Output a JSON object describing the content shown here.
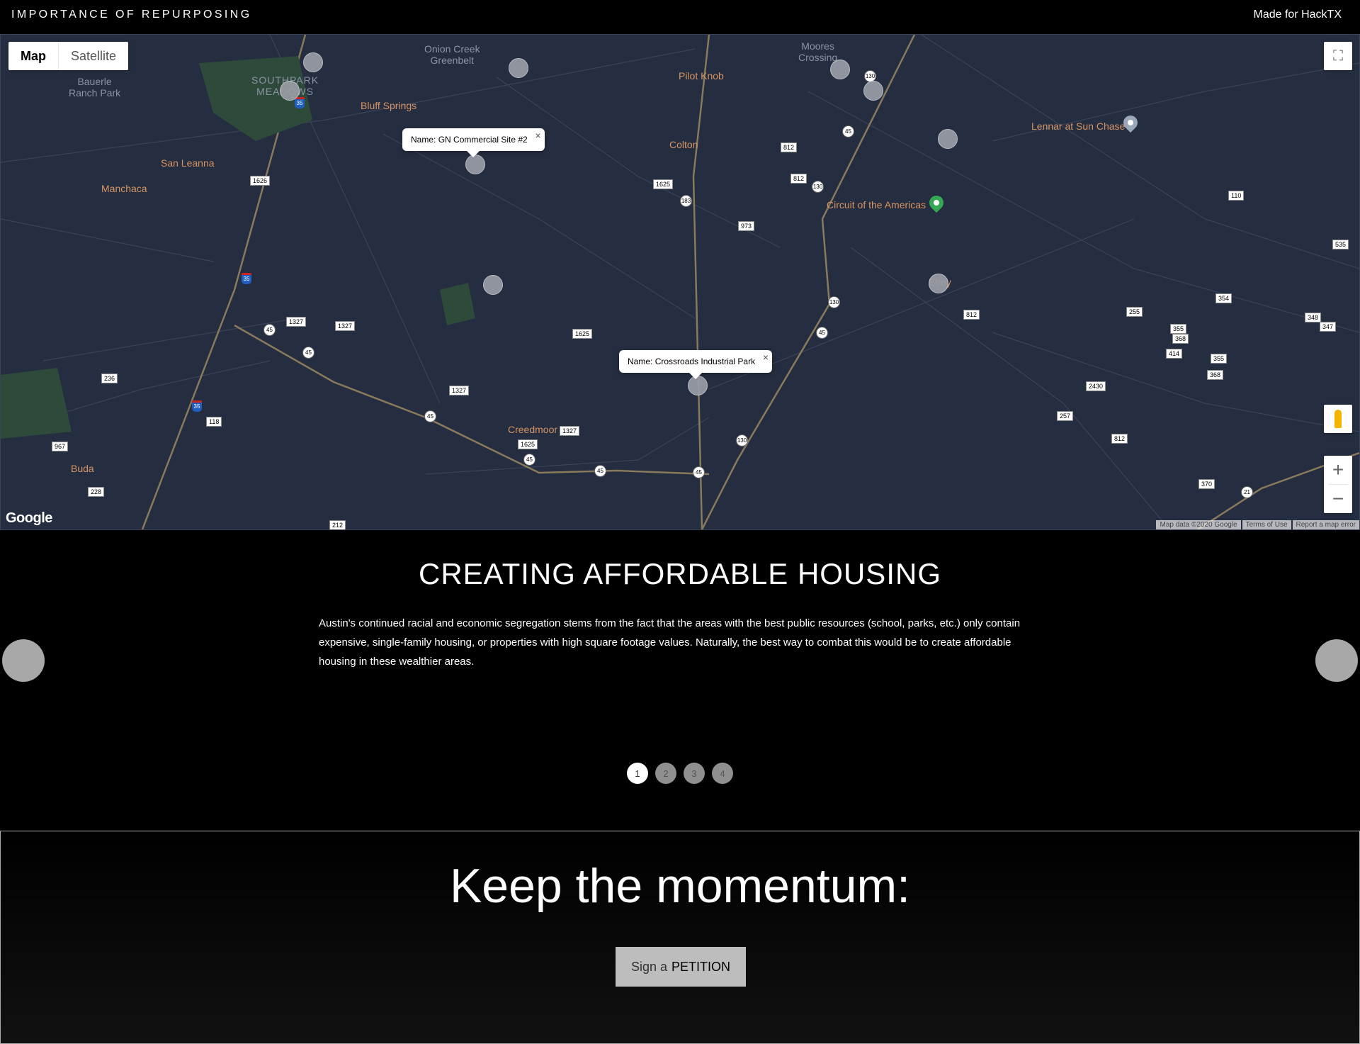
{
  "header": {
    "title": "IMPORTANCE OF REPURPOSING",
    "credit": "Made for HackTX"
  },
  "map": {
    "type_controls": {
      "map_label": "Map",
      "satellite_label": "Satellite",
      "selected": "Map"
    },
    "google_logo": "Google",
    "attribution": {
      "data": "Map data ©2020 Google",
      "terms": "Terms of Use",
      "report": "Report a map error"
    },
    "colors": {
      "background": "#252d40",
      "place_label": "#d59563",
      "marker": "#9a9da6",
      "green_pin": "#34a853"
    },
    "places": {
      "onion_creek": "Onion Creek\nGreenbelt",
      "moores_crossing": "Moores\nCrossing",
      "bauerle": "Bauerle\nRanch Park",
      "southpark": "SOUTHPARK\nMEADOWS",
      "bluff_springs": "Bluff Springs",
      "pilot_knob": "Pilot Knob",
      "san_leanna": "San Leanna",
      "colton": "Colton",
      "lennar": "Lennar at Sun Chase",
      "manchaca": "Manchaca",
      "cota": "Circuit of the Americas",
      "elroy": "Elroy",
      "creedmoor": "Creedmoor",
      "buda": "Buda"
    },
    "info_windows": [
      {
        "label": "Name:",
        "value": "GN Commercial Site #2"
      },
      {
        "label": "Name:",
        "value": "Crossroads Industrial Park"
      }
    ],
    "controls": {
      "zoom_in": "+",
      "zoom_out": "−"
    }
  },
  "carousel": {
    "title": "CREATING AFFORDABLE HOUSING",
    "body": "Austin's continued racial and economic segregation stems from the fact that the areas with the best public resources (school, parks, etc.) only contain expensive, single-family housing, or properties with high square footage values. Naturally, the best way to combat this would be to create affordable housing in these wealthier areas.",
    "pages": [
      "1",
      "2",
      "3",
      "4"
    ],
    "active_page": 1
  },
  "cta": {
    "title": "Keep the momentum:",
    "button_prefix": "Sign a",
    "button_emphasis": "PETITION"
  }
}
